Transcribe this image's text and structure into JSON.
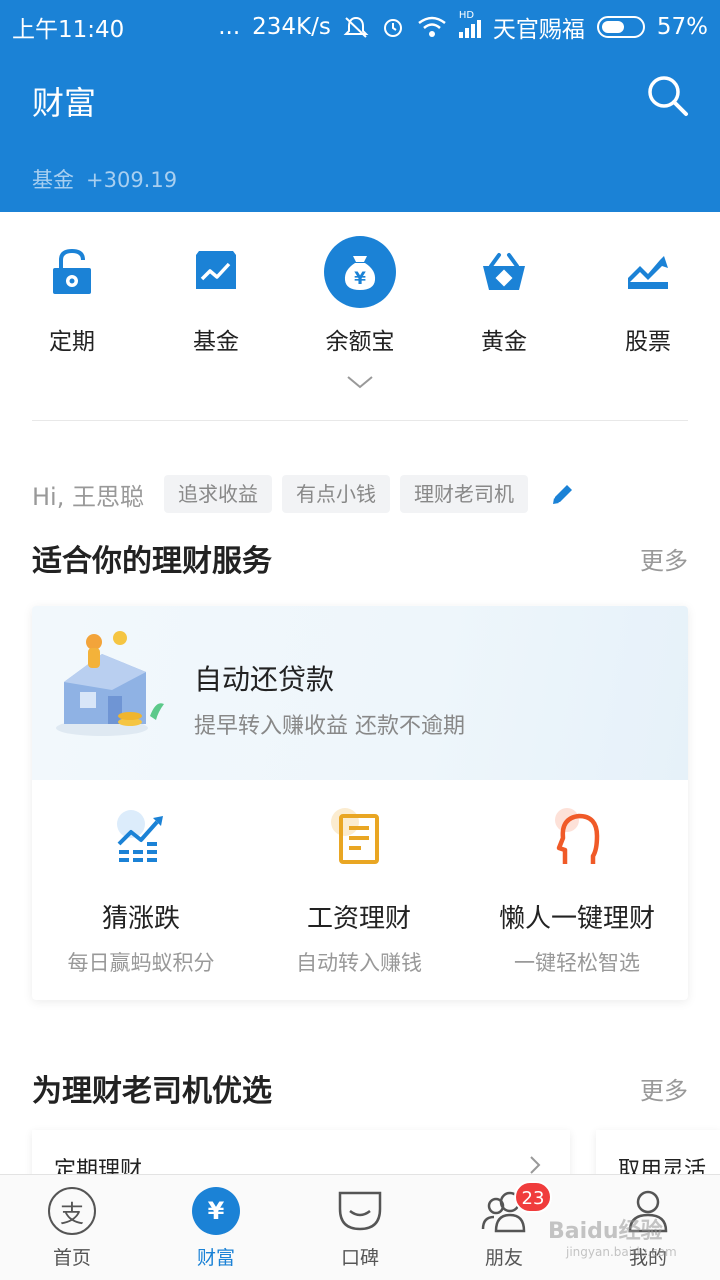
{
  "status_bar": {
    "time": "上午11:40",
    "dots": "...",
    "speed": "234K/s",
    "carrier": "天官赐福",
    "battery": "57%",
    "network_label": "HD"
  },
  "header": {
    "title": "财富",
    "fund_label": "基金",
    "fund_value": "+309.19"
  },
  "quick_entries": [
    {
      "label": "定期",
      "icon": "lock-icon"
    },
    {
      "label": "基金",
      "icon": "fund-chart-icon"
    },
    {
      "label": "余额宝",
      "icon": "yuebao-icon",
      "icon_glyph": "¥"
    },
    {
      "label": "黄金",
      "icon": "gold-icon"
    },
    {
      "label": "股票",
      "icon": "stock-icon"
    }
  ],
  "greeting": {
    "name": "Hi, 王思聪",
    "tags": [
      "追求收益",
      "有点小钱",
      "理财老司机"
    ]
  },
  "section1": {
    "title": "适合你的理财服务",
    "more": "更多"
  },
  "banner": {
    "title": "自动还贷款",
    "subtitle": "提早转入赚收益 还款不逾期"
  },
  "services": [
    {
      "title": "猜涨跌",
      "subtitle": "每日赢蚂蚁积分",
      "icon": "trend-chart-icon"
    },
    {
      "title": "工资理财",
      "subtitle": "自动转入赚钱",
      "icon": "document-icon"
    },
    {
      "title": "懒人一键理财",
      "subtitle": "一键轻松智选",
      "icon": "head-icon"
    }
  ],
  "section2": {
    "title": "为理财老司机优选",
    "more": "更多"
  },
  "product_cards": [
    {
      "title": "定期理财"
    },
    {
      "title": "取用灵活"
    }
  ],
  "tabbar": [
    {
      "label": "首页",
      "icon": "alipay-icon",
      "glyph": "支"
    },
    {
      "label": "财富",
      "icon": "wealth-icon",
      "glyph": "¥",
      "active": true
    },
    {
      "label": "口碑",
      "icon": "koubei-icon"
    },
    {
      "label": "朋友",
      "icon": "friends-icon",
      "badge": "23"
    },
    {
      "label": "我的",
      "icon": "profile-icon"
    }
  ],
  "watermark": {
    "text": "Baidu经验",
    "url": "jingyan.baidu.com"
  },
  "colors": {
    "primary": "#1b82d6",
    "gold": "#e9a623",
    "orange": "#f05a28",
    "badge": "#f03c3c"
  }
}
